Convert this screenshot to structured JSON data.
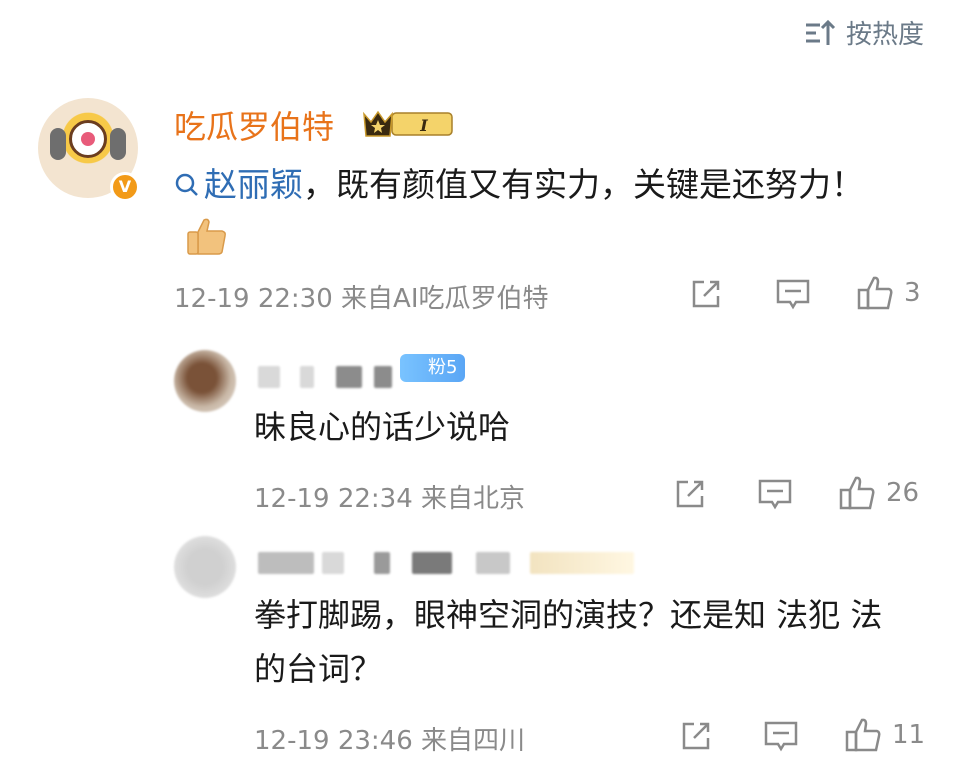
{
  "sort": {
    "label": "按热度",
    "icon": "sort-icon"
  },
  "comments": [
    {
      "username": "吃瓜罗伯特",
      "level_badge": "I",
      "verified_badge": "V",
      "topic": "赵丽颖",
      "text": "，既有颜值又有实力，关键是还努力！",
      "emoji": "thumbs-up-emoji",
      "date": "12-19",
      "time": "22:30",
      "source": "来自AI吃瓜罗伯特",
      "likes": "3"
    },
    {
      "fan_badge": "粉5",
      "text": "昧良心的话少说哈",
      "date": "12-19",
      "time": "22:34",
      "source": "来自北京",
      "likes": "26"
    },
    {
      "text": "拳打脚踢，眼神空洞的演技？还是知 法犯 法的台词？",
      "date": "12-19",
      "time": "23:46",
      "source": "来自四川",
      "likes": "11"
    }
  ],
  "colors": {
    "username_orange": "#e8731a",
    "topic_blue": "#2f6db4",
    "meta_gray": "#8a8a8a",
    "sort_gray": "#6b7a88"
  }
}
